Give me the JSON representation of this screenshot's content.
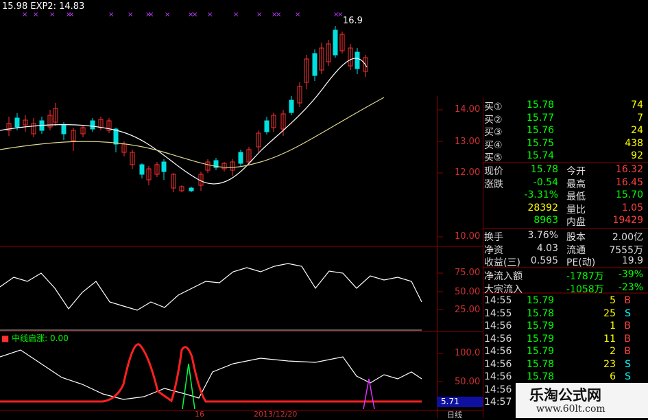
{
  "header": {
    "ma_line": "15.98  EXP2: 14.83"
  },
  "price_marker": "16.9",
  "price_axis": [
    "14.00",
    "13.00",
    "12.00"
  ],
  "kdj_axis": [
    "10.00",
    "75.00",
    "50.00",
    "25.00"
  ],
  "lower_axis": [
    "100.0",
    "50.00"
  ],
  "lower_legend": "中线启涨: 0.00",
  "lower_value_box": "5.71",
  "bottom_fragments": [
    "16",
    "2013/12/20",
    "日线"
  ],
  "buy_orders": [
    {
      "label": "买①",
      "price": "15.78",
      "vol": "74"
    },
    {
      "label": "买②",
      "price": "15.77",
      "vol": "7"
    },
    {
      "label": "买③",
      "price": "15.76",
      "vol": "24"
    },
    {
      "label": "买④",
      "price": "15.75",
      "vol": "438"
    },
    {
      "label": "买⑤",
      "price": "15.74",
      "vol": "92"
    }
  ],
  "stats": [
    {
      "l1": "现价",
      "v1": "15.78",
      "l2": "今开",
      "v2": "16.32"
    },
    {
      "l1": "涨跌",
      "v1": "-0.54",
      "l2": "最高",
      "v2": "16.45"
    },
    {
      "l1": "",
      "v1": "-3.31%",
      "l2": "最低",
      "v2": "15.70"
    },
    {
      "l1": "",
      "v1": "28392",
      "l2": "量比",
      "v2": "1.05"
    },
    {
      "l1": "",
      "v1": "8963",
      "l2": "内盘",
      "v2": "19429"
    }
  ],
  "fundamentals": [
    {
      "l1": "换手",
      "v1": "3.76%",
      "l2": "股本",
      "v2": "2.00亿"
    },
    {
      "l1": "净资",
      "v1": "4.03",
      "l2": "流通",
      "v2": "7555万"
    },
    {
      "l1": "收益(三)",
      "v1": "0.595",
      "l2": "PE(动)",
      "v2": "19.9"
    }
  ],
  "flows": [
    {
      "label": "净流入额",
      "amount": "-1787万",
      "pct": "-39%"
    },
    {
      "label": "大宗流入",
      "amount": "-1058万",
      "pct": "-23%"
    }
  ],
  "ticks": [
    {
      "time": "14:55",
      "price": "15.79",
      "vol": "5",
      "side": "B"
    },
    {
      "time": "14:55",
      "price": "15.78",
      "vol": "25",
      "side": "S"
    },
    {
      "time": "14:56",
      "price": "15.79",
      "vol": "1",
      "side": "B"
    },
    {
      "time": "14:56",
      "price": "15.79",
      "vol": "11",
      "side": "B"
    },
    {
      "time": "14:56",
      "price": "15.79",
      "vol": "2",
      "side": "B"
    },
    {
      "time": "14:56",
      "price": "15.78",
      "vol": "23",
      "side": "S"
    },
    {
      "time": "14:56",
      "price": "15.78",
      "vol": "6",
      "side": "S"
    },
    {
      "time": "14:56",
      "price": "",
      "vol": "",
      "side": ""
    },
    {
      "time": "14:57",
      "price": "",
      "vol": "",
      "side": ""
    }
  ],
  "watermark": {
    "title": "乐淘公式网",
    "url": "www.60lt.com"
  },
  "colors": {
    "up": "#ff3030",
    "down": "#00e0e0",
    "grid": "#8b0000",
    "label": "#d03030",
    "price": "#00ff00",
    "neg": "#00ff00",
    "pos": "#ff4040"
  }
}
